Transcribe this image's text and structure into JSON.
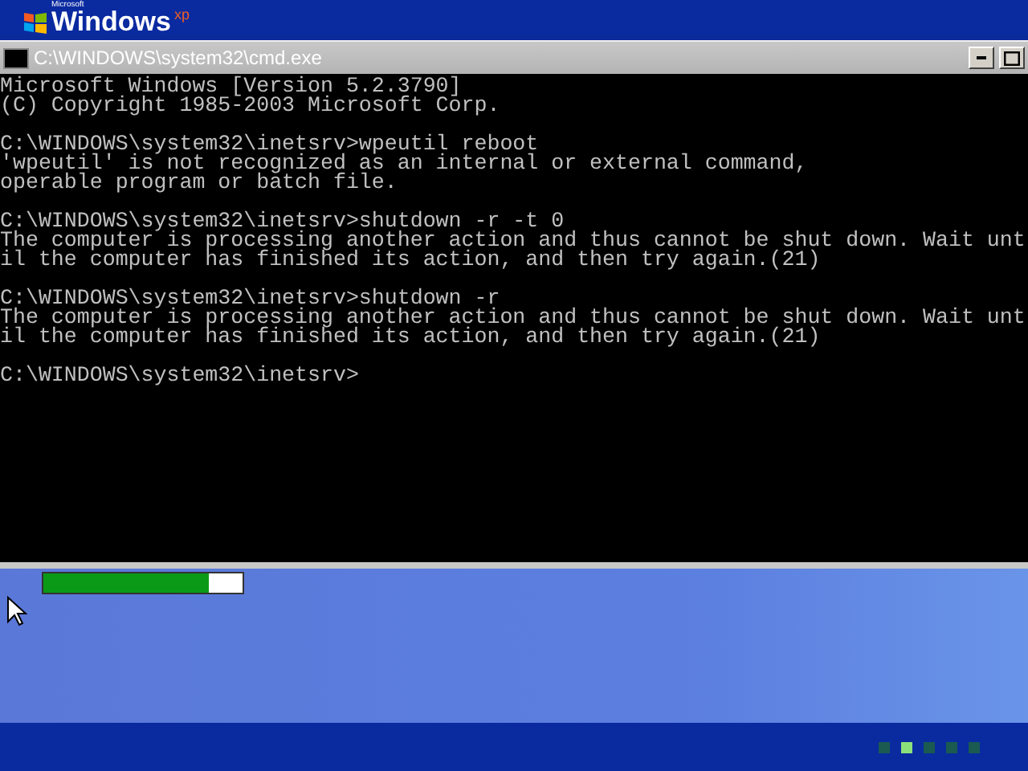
{
  "banner": {
    "maker": "Microsoft",
    "product": "Windows",
    "edition": "xp"
  },
  "window": {
    "title": "C:\\WINDOWS\\system32\\cmd.exe",
    "maximized": false
  },
  "console": {
    "blocks": [
      {
        "lines": [
          "Microsoft Windows [Version 5.2.3790]",
          "(C) Copyright 1985-2003 Microsoft Corp."
        ]
      },
      {
        "lines": [
          "C:\\WINDOWS\\system32\\inetsrv>wpeutil reboot",
          "'wpeutil' is not recognized as an internal or external command,",
          "operable program or batch file."
        ]
      },
      {
        "lines": [
          "C:\\WINDOWS\\system32\\inetsrv>shutdown -r -t 0",
          "The computer is processing another action and thus cannot be shut down. Wait unt",
          "il the computer has finished its action, and then try again.(21)"
        ]
      },
      {
        "lines": [
          "C:\\WINDOWS\\system32\\inetsrv>shutdown -r",
          "The computer is processing another action and thus cannot be shut down. Wait unt",
          "il the computer has finished its action, and then try again.(21)"
        ]
      },
      {
        "lines": [
          "C:\\WINDOWS\\system32\\inetsrv>"
        ]
      }
    ]
  },
  "setup_progress": {
    "level": 0.83
  },
  "indicator_dots": [
    {
      "selected": false
    },
    {
      "selected": true
    },
    {
      "selected": false
    },
    {
      "selected": false
    },
    {
      "selected": false
    }
  ]
}
